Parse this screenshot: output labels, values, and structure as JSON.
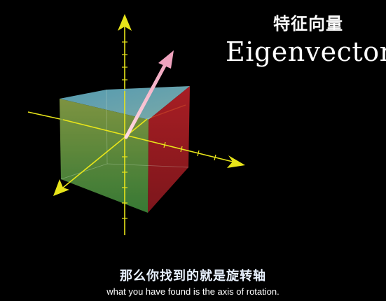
{
  "title": {
    "chinese": "特征向量",
    "english": "Eigenvector"
  },
  "subtitles": {
    "chinese": "那么你找到的就是旋转轴",
    "english": "what you have found is the axis of rotation."
  },
  "colors": {
    "background": "#000000",
    "axis": "#e8e51a",
    "cube_top": "#6fb3c7",
    "cube_front": "#6aa246",
    "cube_side": "#b8202a",
    "eigenvector": "#f2b8c8"
  }
}
